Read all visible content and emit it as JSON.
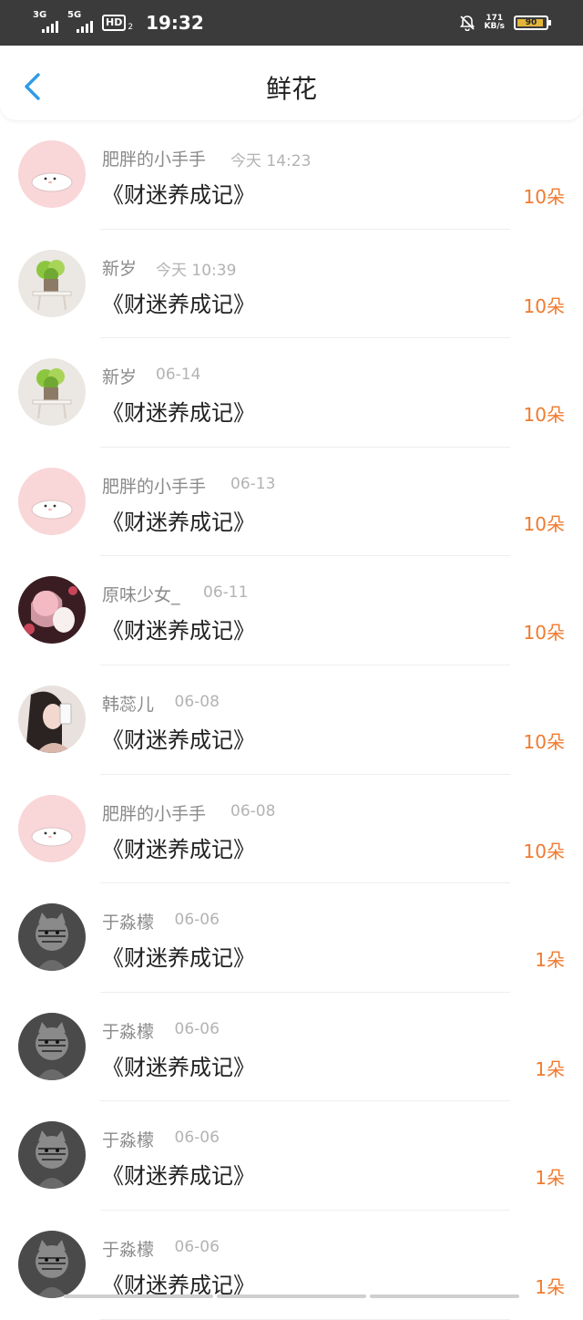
{
  "status_bar": {
    "net1": "3G",
    "net2": "5G",
    "hd": "HD",
    "hd_sub": "2",
    "time": "19:32",
    "speed_value": "171",
    "speed_unit": "KB/s",
    "battery": "90"
  },
  "header": {
    "back_icon": "chevron-left-icon",
    "title": "鲜花"
  },
  "items": [
    {
      "name": "肥胖的小手手",
      "time": "今天 14:23",
      "book": "《财迷养成记》",
      "count": "10朵",
      "avatar": "seal"
    },
    {
      "name": "新岁",
      "time": "今天 10:39",
      "book": "《财迷养成记》",
      "count": "10朵",
      "avatar": "plant"
    },
    {
      "name": "新岁",
      "time": "06-14",
      "book": "《财迷养成记》",
      "count": "10朵",
      "avatar": "plant"
    },
    {
      "name": "肥胖的小手手",
      "time": "06-13",
      "book": "《财迷养成记》",
      "count": "10朵",
      "avatar": "seal"
    },
    {
      "name": "原味少女_",
      "time": "06-11",
      "book": "《财迷养成记》",
      "count": "10朵",
      "avatar": "girl1"
    },
    {
      "name": "韩蕊儿",
      "time": "06-08",
      "book": "《财迷养成记》",
      "count": "10朵",
      "avatar": "girl2"
    },
    {
      "name": "肥胖的小手手",
      "time": "06-08",
      "book": "《财迷养成记》",
      "count": "10朵",
      "avatar": "seal"
    },
    {
      "name": "于淼檬",
      "time": "06-06",
      "book": "《财迷养成记》",
      "count": "1朵",
      "avatar": "cat"
    },
    {
      "name": "于淼檬",
      "time": "06-06",
      "book": "《财迷养成记》",
      "count": "1朵",
      "avatar": "cat"
    },
    {
      "name": "于淼檬",
      "time": "06-06",
      "book": "《财迷养成记》",
      "count": "1朵",
      "avatar": "cat"
    },
    {
      "name": "于淼檬",
      "time": "06-06",
      "book": "《财迷养成记》",
      "count": "1朵",
      "avatar": "cat"
    }
  ],
  "colors": {
    "accent_blue": "#2e9be6",
    "count_orange": "#f07a2e",
    "statusbar_bg": "#3b3b3b"
  }
}
